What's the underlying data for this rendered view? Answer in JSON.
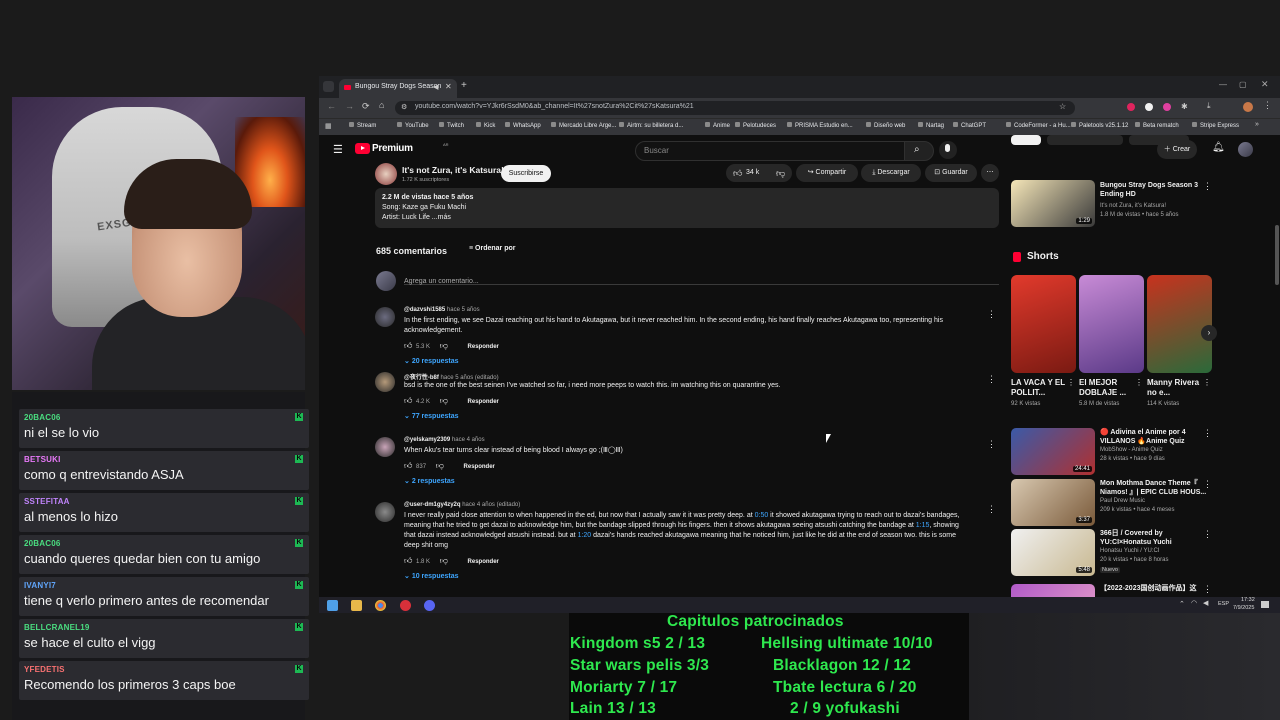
{
  "chat": [
    {
      "user": "20BAC06",
      "color": "#4ade80",
      "text": "ni el se lo vio"
    },
    {
      "user": "BETSUKI",
      "color": "#e879f9",
      "text": "como q entrevistando ASJA"
    },
    {
      "user": "SSTEFITAA",
      "color": "#c084fc",
      "text": "al menos lo hizo"
    },
    {
      "user": "20BAC06",
      "color": "#4ade80",
      "text": "cuando queres quedar bien con tu amigo"
    },
    {
      "user": "IVANYI7",
      "color": "#60a5fa",
      "text": "tiene q verlo primero antes de recomendar"
    },
    {
      "user": "BELLCRANEL19",
      "color": "#4ade80",
      "text": "se hace el culto el vigg"
    },
    {
      "user": "YFEDETIS",
      "color": "#f87171",
      "text": "Recomendo los primeros 3 caps boe"
    }
  ],
  "browser": {
    "tab_title": "Bungou Stray Dogs Season",
    "url": "youtube.com/watch?v=YJkr6rSsdM0&ab_channel=It%27snotZura%2Cit%27sKatsura%21",
    "bookmarks": [
      "Stream",
      "YouTube",
      "Twitch",
      "Kick",
      "WhatsApp",
      "Mercado Libre Arge...",
      "Airtm: su billetera d...",
      "Anime",
      "Pelotudeces",
      "PRISMA Estudio en...",
      "Diseño web",
      "Nartag",
      "ChatGPT",
      "CodeFormer - a Hu...",
      "Paletools v25.1.12",
      "Beta rematch",
      "Stripe Express"
    ]
  },
  "yt": {
    "logo": "Premium",
    "logo_sup": "AR",
    "search_placeholder": "Buscar",
    "create_label": "Crear",
    "channel_name": "It's not Zura, it's Katsura!",
    "subs": "1.72 K suscriptores",
    "subscribe": "Suscribirse",
    "likes": "34 k",
    "share": "Compartir",
    "download": "Descargar",
    "save": "Guardar",
    "desc": [
      "2.2 M de vistas  hace 5 años",
      "Song: Kaze ga Fuku Machi",
      "Artist: Luck Life ...más"
    ],
    "comments_count": "685 comentarios",
    "sort": "Ordenar por",
    "add_comment": "Agrega un comentario...",
    "comments": [
      {
        "author": "@dazvshi1585",
        "time": "hace 5 años",
        "text": "In the first ending, we see Dazai reaching out his hand to Akutagawa, but it never reached him. In the second ending, his hand finally reaches Akutagawa too, representing his acknowledgement.",
        "likes": "5.3 K",
        "reply": "Responder",
        "replies": "20 respuestas",
        "avatar": "#6b6b80"
      },
      {
        "author": "@夜行性-b8f",
        "time": "hace 5 años (editado)",
        "text": "bsd is the one of the best seinen I've watched so far, i need more peeps to watch this. im watching this on quarantine yes.",
        "likes": "4.2 K",
        "reply": "Responder",
        "replies": "77 respuestas",
        "avatar": "#b59a7a"
      },
      {
        "author": "@yelskamy2309",
        "time": "hace 4 años",
        "text": "When Aku's tear turns clear instead of being blood I always go ;(Ⅲ◯Ⅲ)",
        "likes": "837",
        "reply": "Responder",
        "replies": "2 respuestas",
        "avatar": "#c9a4b8"
      },
      {
        "author": "@user-dm1gy4zy2q",
        "time": "hace 4 años (editado)",
        "text_parts": [
          "I never really paid close attention to when happened in the ed, but now that I actually saw it it was pretty deep. at ",
          "0:50",
          " it showed akutagawa trying to reach out to dazai's bandages, meaning that he tried to get dazai to acknowledge him, but the bandage slipped through his fingers. then it shows akutagawa seeing atsushi catching the bandage at ",
          "1:15",
          ", showing that dazai instead acknowledged atsushi instead. but at ",
          "1:20",
          " dazai's hands reached akutagawa meaning that he noticed him, just like he did at the end of season two. this is some deep shit omg"
        ],
        "likes": "1.8 K",
        "reply": "Responder",
        "replies": "10 respuestas",
        "avatar": "#8a8a8a"
      }
    ],
    "sidebar_top": {
      "title": "Bungou Stray Dogs Season 3 Ending HD",
      "channel": "It's not Zura, it's Katsura!",
      "meta": "1.8 M de vistas • hace 5 años",
      "duration": "1:29"
    },
    "shorts_label": "Shorts",
    "shorts": [
      {
        "title": "LA VACA Y EL POLLIT...",
        "views": "92 K vistas",
        "color1": "#e23a2c",
        "color2": "#7a1a12"
      },
      {
        "title": "El MEJOR DOBLAJE ...",
        "views": "5.8 M de vistas",
        "color1": "#c88bd6",
        "color2": "#5b3a88"
      },
      {
        "title": "Manny Rivera no e...",
        "views": "114 K vistas",
        "color1": "#c8321e",
        "color2": "#2a6a3a"
      }
    ],
    "side_videos": [
      {
        "title": "🔴 Adivina el Anime por 4 VILLANOS 🔥Anime Quiz",
        "channel": "MobShow - Anime Quiz",
        "meta": "28 k vistas • hace 9 días",
        "duration": "24:41",
        "c1": "#3a5aa8",
        "c2": "#b03030"
      },
      {
        "title": "Mon Mothma Dance Theme『 Niamos! 』| EPIC CLUB HOUS...",
        "channel": "Paul Drew Music",
        "meta": "209 k vistas • hace 4 meses",
        "duration": "3:37",
        "c1": "#d8c8b0",
        "c2": "#7a5a3a"
      },
      {
        "title": "366日 / Covered by YU:CI×Honatsu Yuchi",
        "channel": "Honatsu Yuchi / YU:CI",
        "meta": "20 k vistas • hace 8 horas",
        "badge": "Nuevo",
        "duration": "5:48",
        "c1": "#f0f0f0",
        "c2": "#c8b890"
      },
      {
        "title": "【2022-2023国创动画作品】这",
        "channel": "",
        "meta": "",
        "duration": "",
        "c1": "#b05ac8",
        "c2": "#e8a0c8"
      }
    ]
  },
  "taskbar": {
    "time": "17:32",
    "date": "7/9/2025",
    "lang": "ESP"
  },
  "sponsor": {
    "title": "Capitulos patrocinados",
    "left": [
      "Kingdom s5 2 / 13",
      "Star wars pelis 3/3",
      "Moriarty 7 / 17",
      "Lain 13 / 13"
    ],
    "right": [
      "Hellsing ultimate 10/10",
      "Blacklagon 12 / 12",
      "Tbate lectura 6 / 20",
      "2 / 9 yofukashi"
    ]
  }
}
